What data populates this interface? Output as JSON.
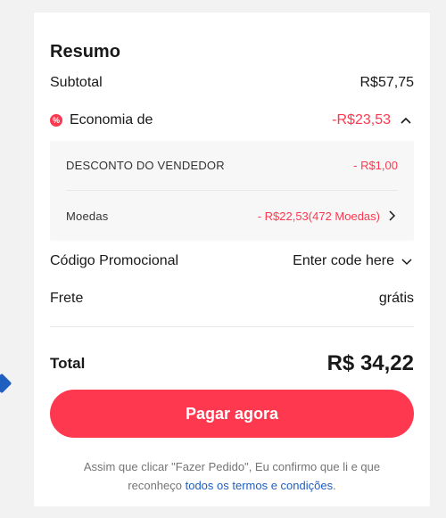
{
  "summary": {
    "title": "Resumo",
    "subtotal_label": "Subtotal",
    "subtotal_value": "R$57,75",
    "savings_label": "Economia de",
    "savings_value": "-R$23,53",
    "sale_icon_glyph": "%",
    "discounts": [
      {
        "label": "DESCONTO DO VENDEDOR",
        "value": "- R$1,00"
      },
      {
        "label": "Moedas",
        "value": "- R$22,53(472 Moedas)"
      }
    ],
    "promo_label": "Código Promocional",
    "promo_placeholder": "Enter code here",
    "shipping_label": "Frete",
    "shipping_value": "grátis",
    "total_label": "Total",
    "total_value": "R$ 34,22",
    "pay_button": "Pagar agora",
    "disclaimer_text": "Assim que clicar \"Fazer Pedido\", Eu confirmo que li e que reconheço ",
    "terms_link": "todos os termos e condições",
    "disclaimer_end": "."
  },
  "colors": {
    "accent": "#fd384f",
    "link": "#1f5fbf"
  },
  "icons": {
    "sale": "sale-badge-icon",
    "collapse": "chevron-up-icon",
    "expand_coins": "chevron-right-icon",
    "promo_dropdown": "chevron-down-icon"
  }
}
